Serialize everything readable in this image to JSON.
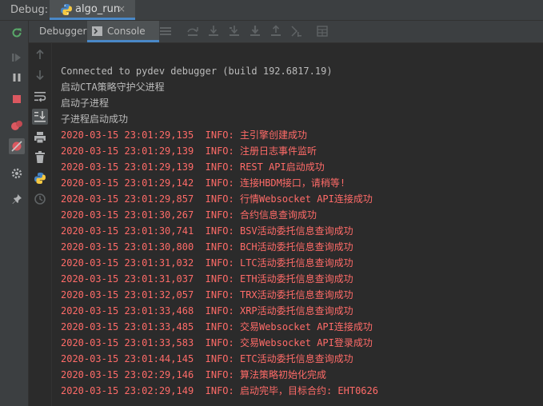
{
  "header": {
    "debug_label": "Debug:",
    "run_tab": {
      "name": "algo_run",
      "icon": "python-icon",
      "close": "×"
    }
  },
  "toolbar": {
    "debugger_label": "Debugger",
    "console_label": "Console",
    "console_icon": "console-icon",
    "accent_color": "#4a88c7"
  },
  "console": {
    "plain_color": "#bbbbbb",
    "info_color": "#ff6b68",
    "lines": [
      {
        "type": "plain",
        "text": "Connected to pydev debugger (build 192.6817.19)"
      },
      {
        "type": "plain",
        "text": "启动CTA策略守护父进程"
      },
      {
        "type": "plain",
        "text": "启动子进程"
      },
      {
        "type": "plain",
        "text": "子进程启动成功"
      },
      {
        "type": "info",
        "text": "2020-03-15 23:01:29,135  INFO: 主引擎创建成功"
      },
      {
        "type": "info",
        "text": "2020-03-15 23:01:29,139  INFO: 注册日志事件监听"
      },
      {
        "type": "info",
        "text": "2020-03-15 23:01:29,139  INFO: REST API启动成功"
      },
      {
        "type": "info",
        "text": "2020-03-15 23:01:29,142  INFO: 连接HBDM接口，请稍等!"
      },
      {
        "type": "info",
        "text": "2020-03-15 23:01:29,857  INFO: 行情Websocket API连接成功"
      },
      {
        "type": "info",
        "text": "2020-03-15 23:01:30,267  INFO: 合约信息查询成功"
      },
      {
        "type": "info",
        "text": "2020-03-15 23:01:30,741  INFO: BSV活动委托信息查询成功"
      },
      {
        "type": "info",
        "text": "2020-03-15 23:01:30,800  INFO: BCH活动委托信息查询成功"
      },
      {
        "type": "info",
        "text": "2020-03-15 23:01:31,032  INFO: LTC活动委托信息查询成功"
      },
      {
        "type": "info",
        "text": "2020-03-15 23:01:31,037  INFO: ETH活动委托信息查询成功"
      },
      {
        "type": "info",
        "text": "2020-03-15 23:01:32,057  INFO: TRX活动委托信息查询成功"
      },
      {
        "type": "info",
        "text": "2020-03-15 23:01:33,468  INFO: XRP活动委托信息查询成功"
      },
      {
        "type": "info",
        "text": "2020-03-15 23:01:33,485  INFO: 交易Websocket API连接成功"
      },
      {
        "type": "info",
        "text": "2020-03-15 23:01:33,583  INFO: 交易Websocket API登录成功"
      },
      {
        "type": "info",
        "text": "2020-03-15 23:01:44,145  INFO: ETC活动委托信息查询成功"
      },
      {
        "type": "info",
        "text": "2020-03-15 23:02:29,146  INFO: 算法策略初始化完成"
      },
      {
        "type": "info",
        "text": "2020-03-15 23:02:29,149  INFO: 启动完毕，目标合约: EHT0626"
      }
    ]
  },
  "icons": {
    "left_toolbar": [
      "rerun-icon",
      "resume-icon",
      "pause-icon",
      "stop-icon",
      "view-breakpoints-icon",
      "mute-breakpoints-icon",
      "settings-icon",
      "pin-icon"
    ],
    "top_toolbar": [
      "menu-icon",
      "step-over-icon",
      "step-into-icon",
      "step-into-my-code-icon",
      "force-step-into-icon",
      "step-out-icon",
      "run-to-cursor-icon",
      "evaluate-icon"
    ],
    "console_side": [
      "scroll-up-icon",
      "scroll-down-icon",
      "soft-wrap-icon",
      "scroll-to-end-icon",
      "print-icon",
      "clear-all-icon",
      "python-console-icon",
      "history-icon"
    ]
  }
}
